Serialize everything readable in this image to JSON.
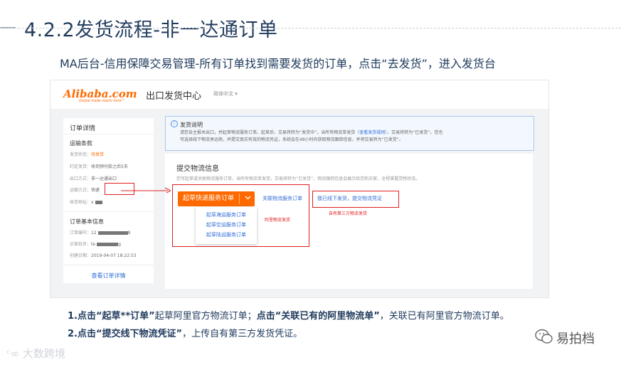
{
  "title": "4.2.2发货流程-非一达通订单",
  "subtitle": "MA后台-信用保障交易管理-所有订单找到需要发货的订单，点击“去发货”，进入发货台",
  "screenshot": {
    "logo_text": "Alibaba.com",
    "logo_sub": "Global trade starts here™",
    "page_title": "出口发货中心",
    "language": "简体中文 ▾",
    "order_panel": {
      "heading": "订单详情",
      "shipping_heading": "运输条款",
      "rows": [
        {
          "label": "发货状态：",
          "value": "待发货",
          "highlight": true
        },
        {
          "label": "约定发货：",
          "value": "收到预付款之后5天",
          "highlight": false
        },
        {
          "label": "出口方式：",
          "value": "非一达通出口",
          "highlight": false
        },
        {
          "label": "运输方式：",
          "value": "快递",
          "highlight": false
        },
        {
          "label": "收货地址：",
          "value": "x",
          "highlight": false
        }
      ],
      "basic_heading": "订单基本信息",
      "basic_rows": [
        {
          "label": "订单编号：",
          "value": "12",
          "suffix": "9"
        },
        {
          "label": "买家姓名：",
          "value": "te",
          "suffix": "g"
        },
        {
          "label": "创建日期：",
          "value": "2019-04-07 18:22:53",
          "suffix": ""
        }
      ],
      "view_link": "查看订单详情"
    },
    "notice": {
      "icon": "info-icon",
      "title": "发货说明",
      "line1_a": "请您自主报关出口，并起草物流服务订单。起草后，交易将转为“发货中”，当所有物流单发货（",
      "line1_link": "查看发货规则",
      "line1_b": "），交易将转为“已发货”。您也",
      "line2": "可选择线下物流承运商，并提交真实有效的物流凭证，系统会在48小时内获取物流跟踪信息，并将交易转为“已发货”。"
    },
    "logistics": {
      "title": "提交物流信息",
      "desc": "您可起草或关联物流服务订单，当所有物流单发货，交易将转为“已发货”。物流跟踪信息会展示给您和买家，全程掌握货物状态。",
      "draft_button": "起草快递服务订单",
      "dropdown_arrow": "chevron-down-icon",
      "dropdown_items": [
        "起草海运服务订单",
        "起草空运服务订单",
        "起草陆运服务订单"
      ],
      "associate_link": "关联物流服务订单",
      "offline_link": "我已线下发货，提交物流凭证",
      "annotation_ali": "阿里物流发货",
      "annotation_third": "自有第三方物流发货"
    }
  },
  "notes": {
    "line1_n": "1.",
    "line1_b1": "点击“起草**订单”",
    "line1_t1": "起草阿里官方物流订单；",
    "line1_b2": "点击“关联已有的阿里物流单”",
    "line1_t2": "，关联已有阿里官方物流订单。",
    "line2_n": "2.",
    "line2_b1": "点击“提交线下物流凭证”",
    "line2_t1": "，上传自有第三方发货凭证。"
  },
  "watermark_left": "大数跨境",
  "watermark_right": "易拍档",
  "colors": {
    "accent": "#ff6a00",
    "title": "#1f3a5c",
    "link": "#2d6cd6",
    "annotation": "#e02020"
  }
}
